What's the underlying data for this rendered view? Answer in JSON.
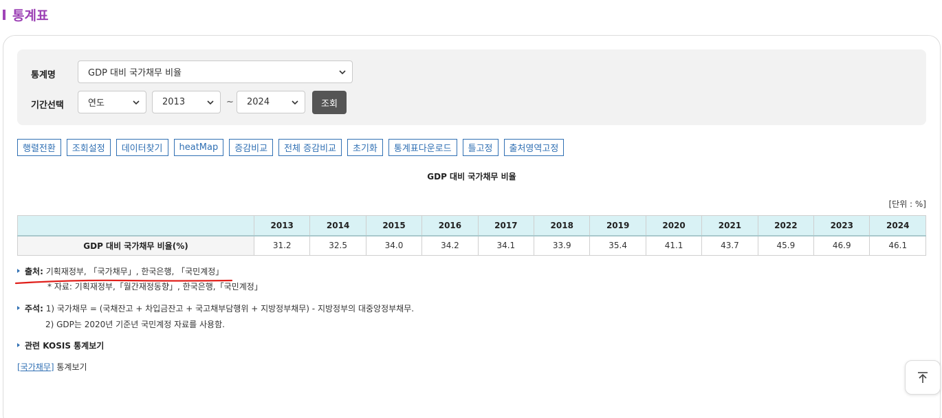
{
  "page": {
    "title": "통계표"
  },
  "search": {
    "stat_label": "통계명",
    "stat_value": "GDP 대비 국가채무 비율",
    "period_label": "기간선택",
    "period_type": "연도",
    "start_year": "2013",
    "tilde": "~",
    "end_year": "2024",
    "search_button": "조회"
  },
  "toolbar": {
    "items": [
      "행렬전환",
      "조회설정",
      "데이터찾기",
      "heatMap",
      "증감비교",
      "전체 증감비교",
      "초기화",
      "통계표다운로드",
      "틀고정",
      "출처영역고정"
    ]
  },
  "table": {
    "title": "GDP 대비 국가채무 비율",
    "unit": "[단위 : %]",
    "years": [
      "2013",
      "2014",
      "2015",
      "2016",
      "2017",
      "2018",
      "2019",
      "2020",
      "2021",
      "2022",
      "2023",
      "2024"
    ],
    "row_label": "GDP 대비 국가채무 비율(%)",
    "values": [
      "31.2",
      "32.5",
      "34.0",
      "34.2",
      "34.1",
      "33.9",
      "35.4",
      "41.1",
      "43.7",
      "45.9",
      "46.9",
      "46.1"
    ]
  },
  "notes": {
    "source_label": "출처:",
    "source_text": "기획재정부, 「국가채무」, 한국은행, 「국민계정」",
    "source_sub": "* 자료: 기획재정부,「월간재정동향」, 한국은행,「국민계정」",
    "remark_label": "주석:",
    "remark_1": "1) 국가채무 = (국채잔고 + 차입금잔고 + 국고채부담행위 + 지방정부채무) - 지방정부의 대중앙정부채무.",
    "remark_2": "2) GDP는 2020년 기준년 국민계정 자료를 사용함.",
    "related_label": "관련 KOSIS 통계보기",
    "related_link": "[국가채무]",
    "related_suffix": "통계보기"
  },
  "colors": {
    "accent": "#9b3fb4",
    "link": "#2f6fb3",
    "header_bg": "#d9f2f5",
    "underline": "#e0201b"
  }
}
